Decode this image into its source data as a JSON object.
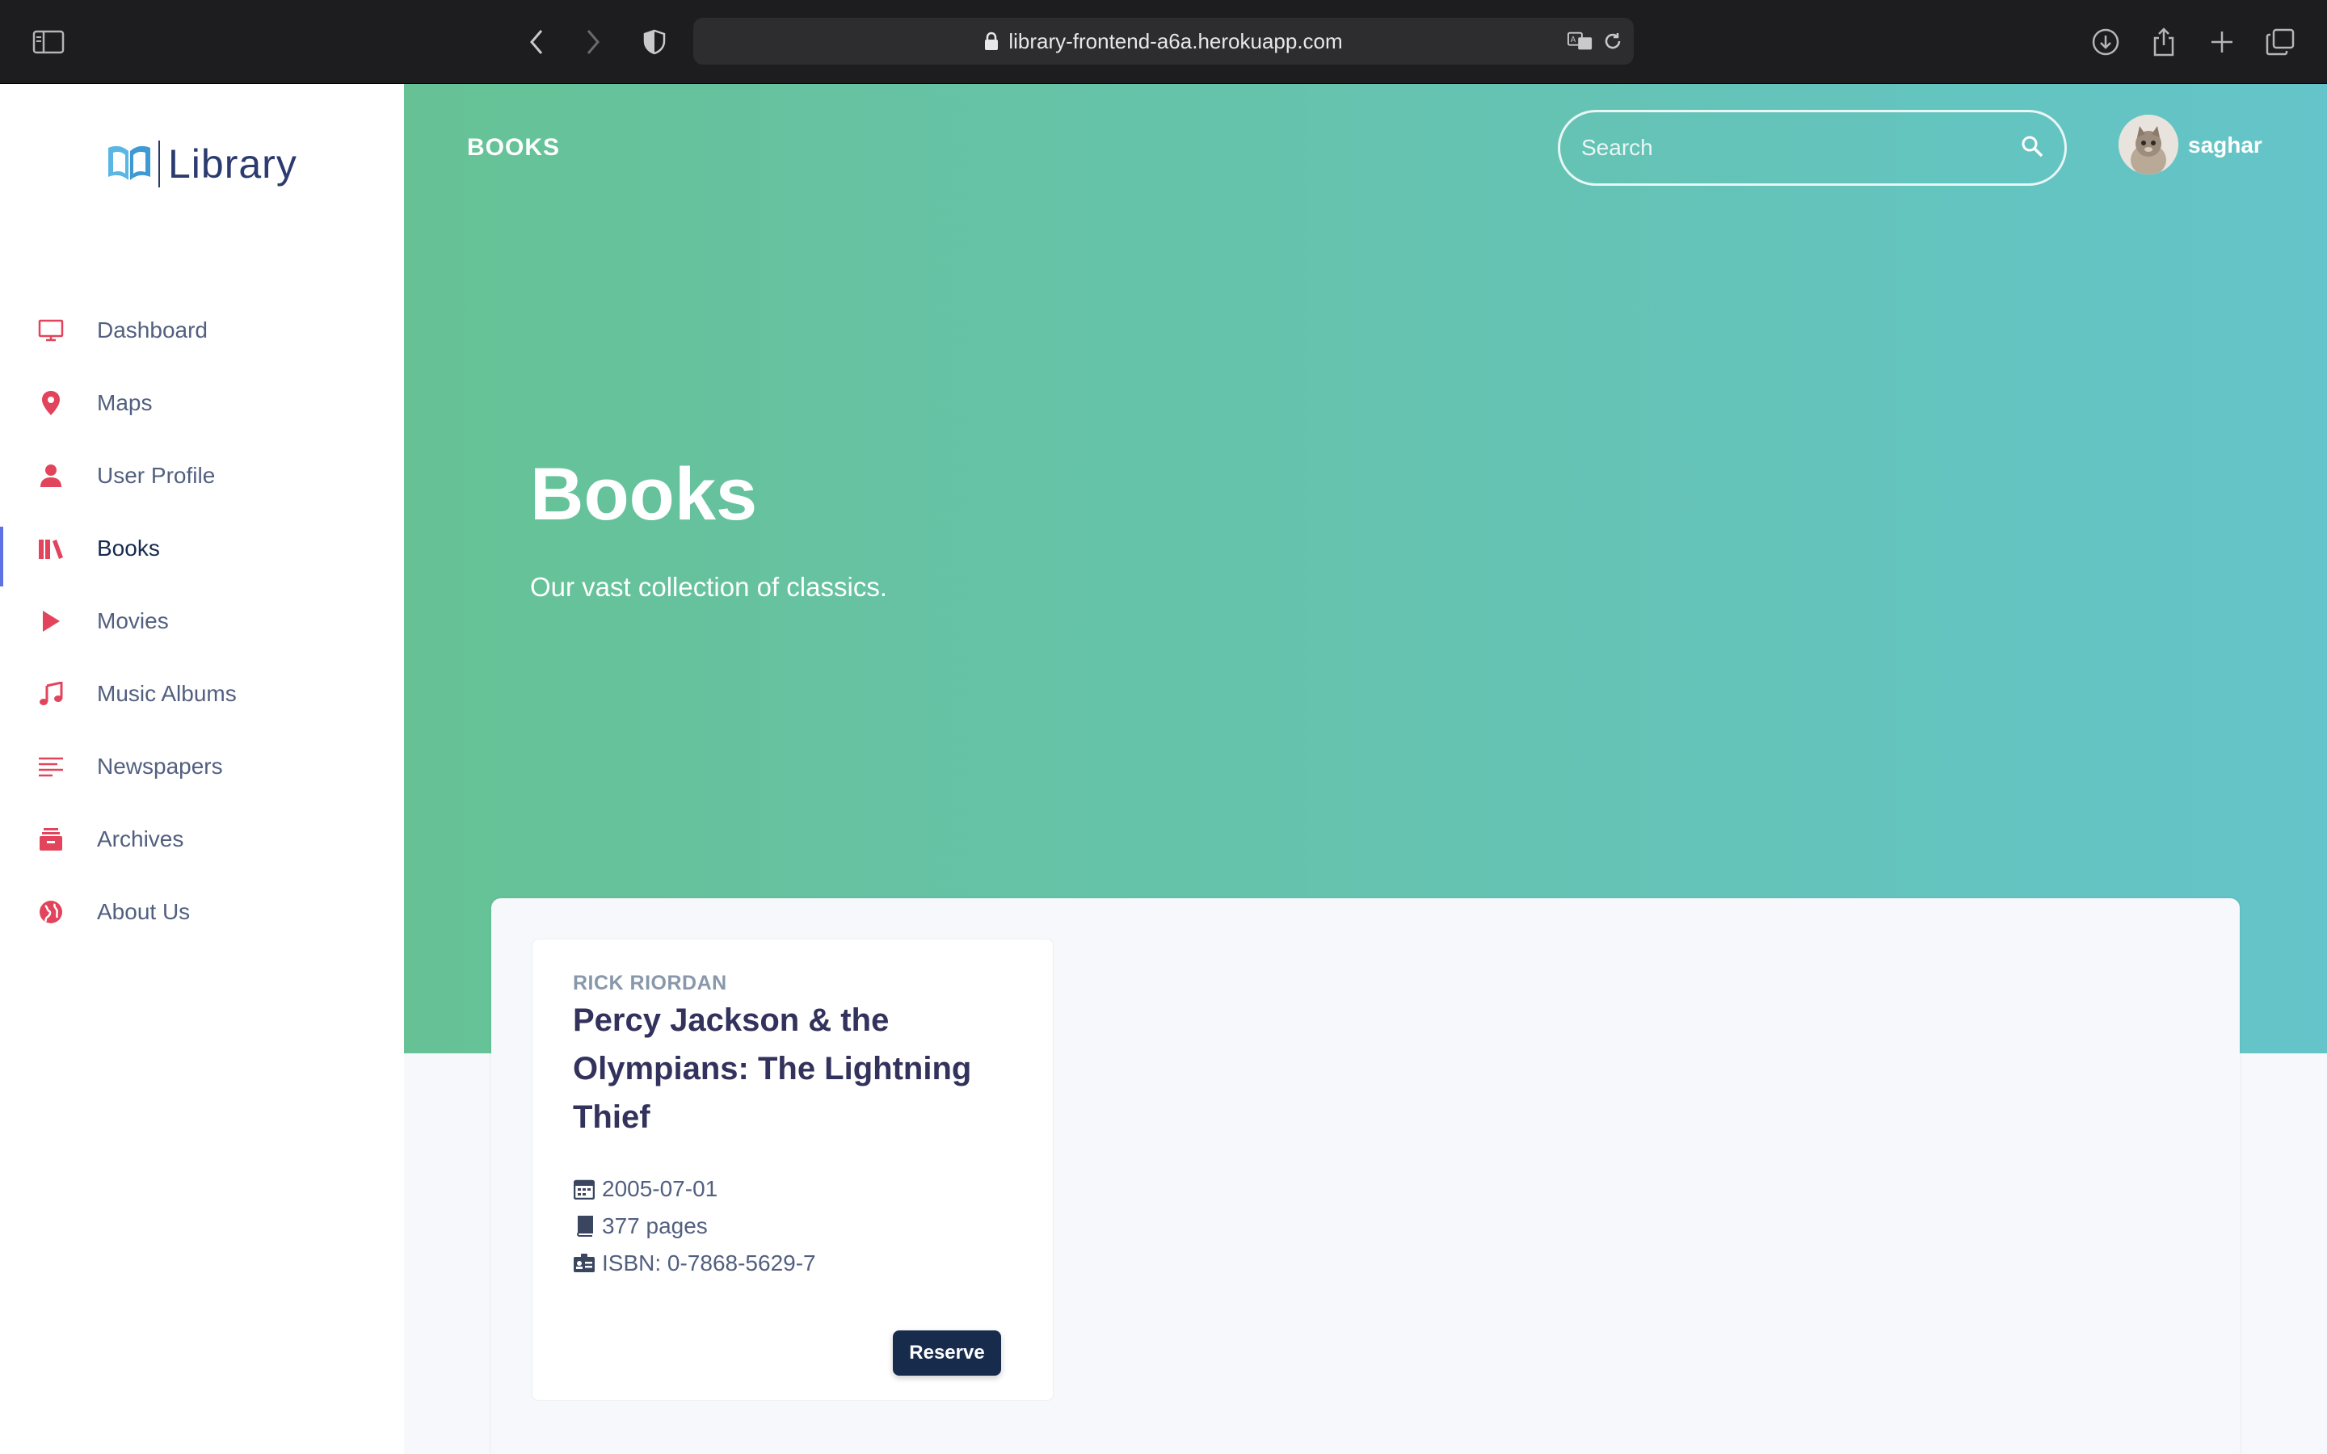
{
  "browser": {
    "url": "library-frontend-a6a.herokuapp.com"
  },
  "sidebar": {
    "logo_text": "Library",
    "items": [
      {
        "label": "Dashboard",
        "icon": "monitor-icon"
      },
      {
        "label": "Maps",
        "icon": "map-pin-icon"
      },
      {
        "label": "User Profile",
        "icon": "user-icon"
      },
      {
        "label": "Books",
        "icon": "books-icon",
        "active": true
      },
      {
        "label": "Movies",
        "icon": "play-icon"
      },
      {
        "label": "Music Albums",
        "icon": "music-note-icon"
      },
      {
        "label": "Newspapers",
        "icon": "lines-icon"
      },
      {
        "label": "Archives",
        "icon": "archive-icon"
      },
      {
        "label": "About Us",
        "icon": "globe-icon"
      }
    ]
  },
  "header": {
    "section_title": "BOOKS",
    "search_placeholder": "Search",
    "user_name": "saghar"
  },
  "hero": {
    "title": "Books",
    "subtitle": "Our vast collection of classics."
  },
  "books": [
    {
      "author": "RICK RIORDAN",
      "title": "Percy Jackson & the Olympians: The Lightning Thief",
      "date": "2005-07-01",
      "pages": "377 pages",
      "isbn": "ISBN: 0-7868-5629-7",
      "action_label": "Reserve"
    }
  ],
  "colors": {
    "accent": "#e2445c",
    "gradient_start": "#66c295",
    "gradient_end": "#64c4c9",
    "button_dark": "#172b4d",
    "active_indicator": "#5e72e4"
  }
}
